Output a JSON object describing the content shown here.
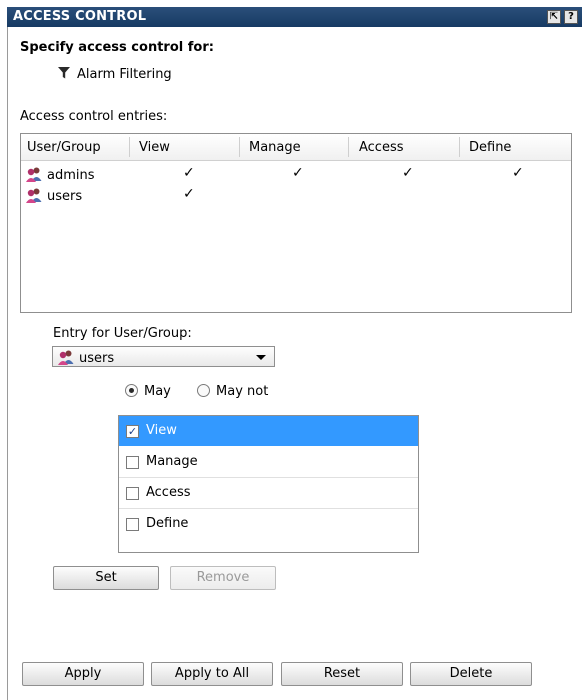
{
  "panel": {
    "title": "ACCESS CONTROL",
    "restore_glyph": "⇱",
    "help_glyph": "?"
  },
  "target": {
    "heading": "Specify access control for:",
    "object_name": "Alarm Filtering",
    "object_icon": "funnel-icon"
  },
  "entries": {
    "label": "Access control entries:",
    "columns": [
      "User/Group",
      "View",
      "Manage",
      "Access",
      "Define"
    ],
    "rows": [
      {
        "name": "admins",
        "view": "✓",
        "manage": "✓",
        "access": "✓",
        "define": "✓"
      },
      {
        "name": "users",
        "view": "✓",
        "manage": "",
        "access": "",
        "define": ""
      }
    ]
  },
  "entry_form": {
    "label": "Entry for User/Group:",
    "selected_group": "users",
    "may_label": "May",
    "may_not_label": "May not",
    "selected_mode": "May",
    "permissions": [
      {
        "label": "View",
        "checked": true,
        "selected": true,
        "mark": "✓"
      },
      {
        "label": "Manage",
        "checked": false,
        "selected": false,
        "mark": ""
      },
      {
        "label": "Access",
        "checked": false,
        "selected": false,
        "mark": ""
      },
      {
        "label": "Define",
        "checked": false,
        "selected": false,
        "mark": ""
      }
    ],
    "set_label": "Set",
    "remove_label": "Remove"
  },
  "footer": {
    "apply_label": "Apply",
    "apply_all_label": "Apply to All",
    "reset_label": "Reset",
    "delete_label": "Delete"
  },
  "colors": {
    "title_bar": "#1e416b",
    "selection": "#3399ff"
  }
}
